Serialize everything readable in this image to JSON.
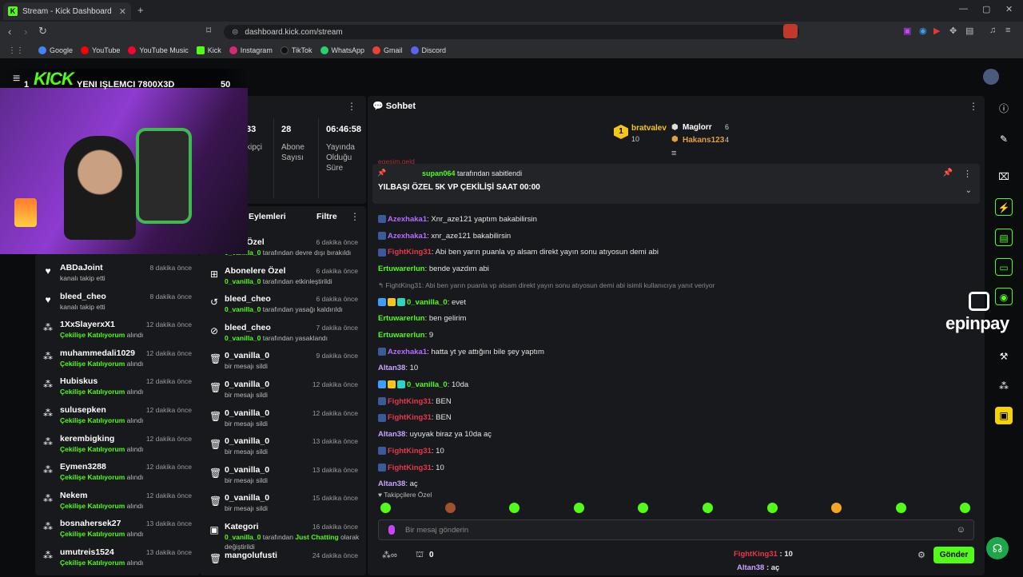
{
  "browser": {
    "tab_title": "Stream - Kick Dashboard",
    "url": "dashboard.kick.com/stream",
    "bookmarks": [
      "Google",
      "YouTube",
      "YouTube Music",
      "Kick",
      "Instagram",
      "TikTok",
      "WhatsApp",
      "Gmail",
      "Discord"
    ]
  },
  "overlay": {
    "rank": "1",
    "title": "YENI IŞLEMCI 7800X3D",
    "count": "50"
  },
  "stats": {
    "followers_value": "33",
    "followers_label": "kipçi",
    "subs_value": "28",
    "subs_label_1": "Abone",
    "subs_label_2": "Sayısı",
    "live_value": "06:46:58",
    "live_label_1": "Yayında",
    "live_label_2": "Olduğu",
    "live_label_3": "Süre"
  },
  "activity_left": [
    {
      "name": "ABDaJoint",
      "time": "8 dakika önce",
      "sub": "kanalı takip etti",
      "icon": "heart"
    },
    {
      "name": "bleed_cheo",
      "time": "8 dakika önce",
      "sub": "kanalı takip etti",
      "icon": "heart"
    },
    {
      "name": "1XxSlayerxX1",
      "time": "12 dakika önce",
      "sub_green": "Çekilişe Katılıyorum",
      "sub_rest": " alındı",
      "icon": "bubbles"
    },
    {
      "name": "muhammedali1029",
      "time": "12 dakika önce",
      "sub_green": "Çekilişe Katılıyorum",
      "sub_rest": " alındı",
      "icon": "bubbles"
    },
    {
      "name": "Hubiskus",
      "time": "12 dakika önce",
      "sub_green": "Çekilişe Katılıyorum",
      "sub_rest": " alındı",
      "icon": "bubbles"
    },
    {
      "name": "sulusepken",
      "time": "12 dakika önce",
      "sub_green": "Çekilişe Katılıyorum",
      "sub_rest": " alındı",
      "icon": "bubbles"
    },
    {
      "name": "kerembigking",
      "time": "12 dakika önce",
      "sub_green": "Çekilişe Katılıyorum",
      "sub_rest": " alındı",
      "icon": "bubbles"
    },
    {
      "name": "Eymen3288",
      "time": "12 dakika önce",
      "sub_green": "Çekilişe Katılıyorum",
      "sub_rest": " alındı",
      "icon": "bubbles"
    },
    {
      "name": "Nekem",
      "time": "12 dakika önce",
      "sub_green": "Çekilişe Katılıyorum",
      "sub_rest": " alındı",
      "icon": "bubbles"
    },
    {
      "name": "bosnahersek27",
      "time": "13 dakika önce",
      "sub_green": "Çekilişe Katılıyorum",
      "sub_rest": " alındı",
      "icon": "bubbles"
    },
    {
      "name": "umutreis1524",
      "time": "13 dakika önce",
      "sub_green": "Çekilişe Katılıyorum",
      "sub_rest": " alındı",
      "icon": "bubbles"
    }
  ],
  "moderation": {
    "title": "Eylemleri",
    "filter": "Filtre",
    "items": [
      {
        "name": "elere Özel",
        "time": "6 dakika önce",
        "user": "0_vanilla_0",
        "rest": " tarafından devre dışı bırakıldı",
        "icon": "none"
      },
      {
        "name": "Abonelere Özel",
        "time": "6 dakika önce",
        "user": "0_vanilla_0",
        "rest": " tarafından etkinleştirildi",
        "icon": "gift"
      },
      {
        "name": "bleed_cheo",
        "time": "6 dakika önce",
        "user": "0_vanilla_0",
        "rest": " tarafından yasağı kaldırıldı",
        "icon": "undo"
      },
      {
        "name": "bleed_cheo",
        "time": "7 dakika önce",
        "user": "0_vanilla_0",
        "rest": " tarafından yasaklandı",
        "icon": "ban"
      },
      {
        "name": "0_vanilla_0",
        "time": "9 dakika önce",
        "rest": "bir mesajı sildi",
        "icon": "trash"
      },
      {
        "name": "0_vanilla_0",
        "time": "12 dakika önce",
        "rest": "bir mesajı sildi",
        "icon": "trash"
      },
      {
        "name": "0_vanilla_0",
        "time": "12 dakika önce",
        "rest": "bir mesajı sildi",
        "icon": "trash"
      },
      {
        "name": "0_vanilla_0",
        "time": "13 dakika önce",
        "rest": "bir mesajı sildi",
        "icon": "trash"
      },
      {
        "name": "0_vanilla_0",
        "time": "13 dakika önce",
        "rest": "bir mesajı sildi",
        "icon": "trash"
      },
      {
        "name": "0_vanilla_0",
        "time": "15 dakika önce",
        "rest": "bir mesajı sildi",
        "icon": "trash"
      },
      {
        "name": "Kategori",
        "time": "16 dakika önce",
        "user": "0_vanilla_0",
        "rest": " tarafından ",
        "cat": "Just Chatting",
        "rest2": " olarak",
        "line2": "değiştirildi",
        "icon": "cat"
      },
      {
        "name": "mangolufusti",
        "time": "24 dakika önce",
        "rest": "",
        "icon": "trash"
      }
    ]
  },
  "chat": {
    "title": "Sohbet",
    "top": {
      "first_name": "bratvalev",
      "first_count": "10",
      "first_rank": "1",
      "second_name": "Maglorr",
      "second_count": "6",
      "third_name": "Hakans123",
      "third_count": "4"
    },
    "partial_top": "egesim.geld",
    "pinned": {
      "by": "supan064",
      "by_rest": " tarafından sabitlendi",
      "text": "YILBAŞI ÖZEL 5K VP ÇEKİLİŞİ SAAT 00:00"
    },
    "messages": [
      {
        "user": "Azexhaka1",
        "cls": "purple",
        "text": ": Xnr_aze121 yaptım bakabilirsin",
        "badge": true
      },
      {
        "user": "Azexhaka1",
        "cls": "purple",
        "text": ": xnr_aze121 bakabilirsin",
        "badge": true
      },
      {
        "user": "FightKing31",
        "cls": "red",
        "text": ": Abi ben yarın puanla vp alsam direkt yayın sonu atıyosun demi abi",
        "badge": true
      },
      {
        "user": "Ertuwarerlun",
        "cls": "green",
        "text": ": bende yazdım abi"
      },
      {
        "reply": "FightKing31: Abi ben yarın puanla vp alsam direkt yayın sonu atıyosun demi abi isimli kullanıcıya yanıt veriyor"
      },
      {
        "user": "0_vanilla_0",
        "cls": "green",
        "text": ": evet",
        "badges3": true
      },
      {
        "user": "Ertuwarerlun",
        "cls": "green",
        "text": ": ben gelirim"
      },
      {
        "user": "Ertuwarerlun",
        "cls": "green",
        "text": ": 9"
      },
      {
        "user": "Azexhaka1",
        "cls": "purple",
        "text": ": hatta yt ye attığını bile şey yaptım",
        "badge": true
      },
      {
        "user": "Altan38",
        "cls": "lav",
        "text": ": 10"
      },
      {
        "user": "0_vanilla_0",
        "cls": "green",
        "text": ": 10da",
        "badges3": true
      },
      {
        "user": "FightKing31",
        "cls": "red",
        "text": ": BEN",
        "badge": true
      },
      {
        "user": "FightKing31",
        "cls": "red",
        "text": ": BEN",
        "badge": true
      },
      {
        "user": "Altan38",
        "cls": "lav",
        "text": ": uyuyak biraz ya 10da aç"
      },
      {
        "user": "FightKing31",
        "cls": "red",
        "text": ": 10",
        "badge": true
      },
      {
        "user": "FightKing31",
        "cls": "red",
        "text": ": 10",
        "badge": true
      },
      {
        "user": "Altan38",
        "cls": "lav",
        "text": ": aç"
      }
    ],
    "followers_only": "Takipçilere Özel",
    "input_placeholder": "Bir mesaj gönderin",
    "points": "0",
    "send_label": "Gönder",
    "preview": [
      {
        "user": "FightKing31",
        "text": " : 10"
      },
      {
        "user": "Altan38",
        "text": " : aç"
      }
    ]
  },
  "brand_overlay": "epinpay",
  "colors": {
    "accent": "#53fc18",
    "bg": "#0b0c0e",
    "panel": "#18191c"
  }
}
